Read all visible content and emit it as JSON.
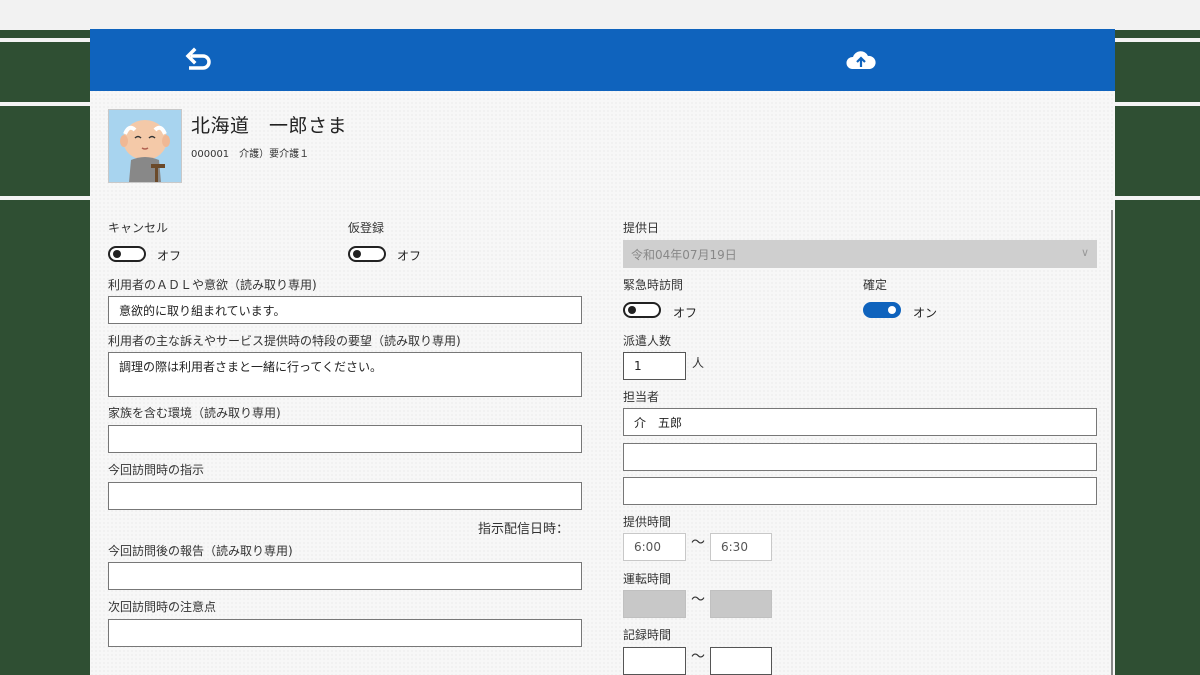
{
  "patient": {
    "name": "北海道　一郎さま",
    "sub": "000001　介護）要介護１"
  },
  "left": {
    "cancel_label": "キャンセル",
    "cancel_state": "オフ",
    "temp_label": "仮登録",
    "temp_state": "オフ",
    "adl_label": "利用者のＡＤＬや意欲（読み取り専用)",
    "adl_value": "意欲的に取り組まれています。",
    "request_label": "利用者の主な訴えやサービス提供時の特段の要望（読み取り専用)",
    "request_value": "調理の際は利用者さまと一緒に行ってください。",
    "family_label": "家族を含む環境（読み取り専用)",
    "family_value": "",
    "instruction_label": "今回訪問時の指示",
    "instruction_value": "",
    "instruction_date_label": "指示配信日時：",
    "report_label": "今回訪問後の報告（読み取り専用)",
    "report_value": "",
    "next_label": "次回訪問時の注意点",
    "next_value": ""
  },
  "right": {
    "date_label": "提供日",
    "date_value": "令和04年07月19日",
    "emergency_label": "緊急時訪問",
    "emergency_state": "オフ",
    "confirm_label": "確定",
    "confirm_state": "オン",
    "dispatch_label": "派遣人数",
    "dispatch_value": "1",
    "dispatch_unit": "人",
    "staff_label": "担当者",
    "staff_1": "介　五郎",
    "staff_2": "",
    "staff_3": "",
    "service_time_label": "提供時間",
    "service_start": "6:00",
    "service_end": "6:30",
    "tilde": "～",
    "drive_time_label": "運転時間",
    "record_time_label": "記録時間"
  },
  "colors": {
    "header": "#0f63bd",
    "background": "#2f4f33",
    "panel": "#f7f7f7"
  },
  "icons": {
    "back": "return-arrow-icon",
    "upload": "cloud-upload-icon",
    "dropdown": "chevron-down-icon"
  }
}
